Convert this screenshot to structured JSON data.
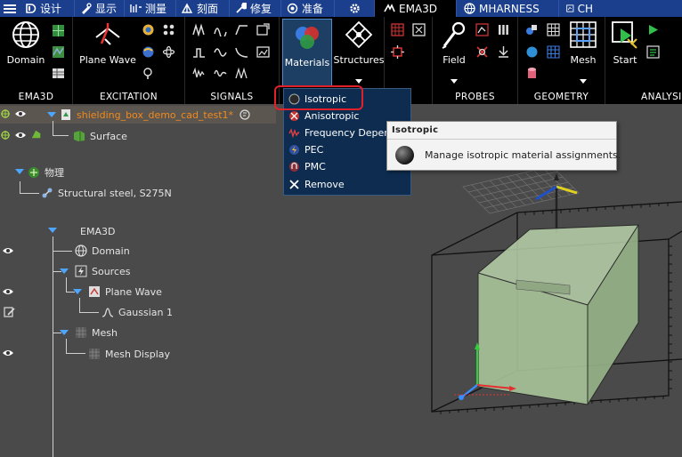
{
  "tabs": [
    {
      "label": "设计",
      "icon": "design-icon"
    },
    {
      "label": "显示",
      "icon": "display-icon"
    },
    {
      "label": "测量",
      "icon": "measure-icon"
    },
    {
      "label": "刻面",
      "icon": "facet-icon"
    },
    {
      "label": "修复",
      "icon": "repair-icon"
    },
    {
      "label": "准备",
      "icon": "prepare-icon"
    },
    {
      "label": "",
      "icon": "gear-icon"
    },
    {
      "label": "EMA3D",
      "icon": "ema3d-icon",
      "active": true
    },
    {
      "label": "MHARNESS",
      "icon": "globe-icon"
    },
    {
      "label": "CH",
      "icon": "chart-icon"
    }
  ],
  "ribbon": {
    "groups": {
      "ema3d": "EMA3D",
      "excitation": "EXCITATION",
      "signals": "SIGNALS",
      "probes": "PROBES",
      "geometry": "GEOMETRY",
      "analysis": "ANALYSIS"
    },
    "buttons": {
      "domain": "Domain",
      "plane_wave": "Plane Wave",
      "materials": "Materials",
      "structures": "Structures",
      "field": "Field",
      "mesh": "Mesh",
      "start": "Start"
    }
  },
  "materials_menu": {
    "items": [
      {
        "label": "Isotropic",
        "icon": "isotropic-icon"
      },
      {
        "label": "Anisotropic",
        "icon": "anisotropic-icon"
      },
      {
        "label": "Frequency Depen",
        "icon": "frequency-icon"
      },
      {
        "label": "PEC",
        "icon": "pec-icon"
      },
      {
        "label": "PMC",
        "icon": "pmc-icon"
      },
      {
        "label": "Remove",
        "icon": "remove-icon"
      }
    ]
  },
  "tooltip": {
    "title": "Isotropic",
    "description": "Manage isotropic material assignments."
  },
  "tree": {
    "root": "shielding_box_demo_cad_test1*",
    "surface": "Surface",
    "physics": "物理",
    "material": "Structural steel, S275N",
    "ema3d": "EMA3D",
    "domain": "Domain",
    "sources": "Sources",
    "plane_wave": "Plane Wave",
    "gaussian": "Gaussian 1",
    "mesh": "Mesh",
    "mesh_display": "Mesh Display"
  },
  "colors": {
    "tab_bar": "#1b3f8c",
    "ribbon_bg": "#000000",
    "viewport_bg": "#4a4a4a",
    "warning_text": "#f08a1e",
    "dropdown_bg": "#0d2c4f",
    "highlight": "#e0202a",
    "box_fill": "#a9c49a"
  }
}
